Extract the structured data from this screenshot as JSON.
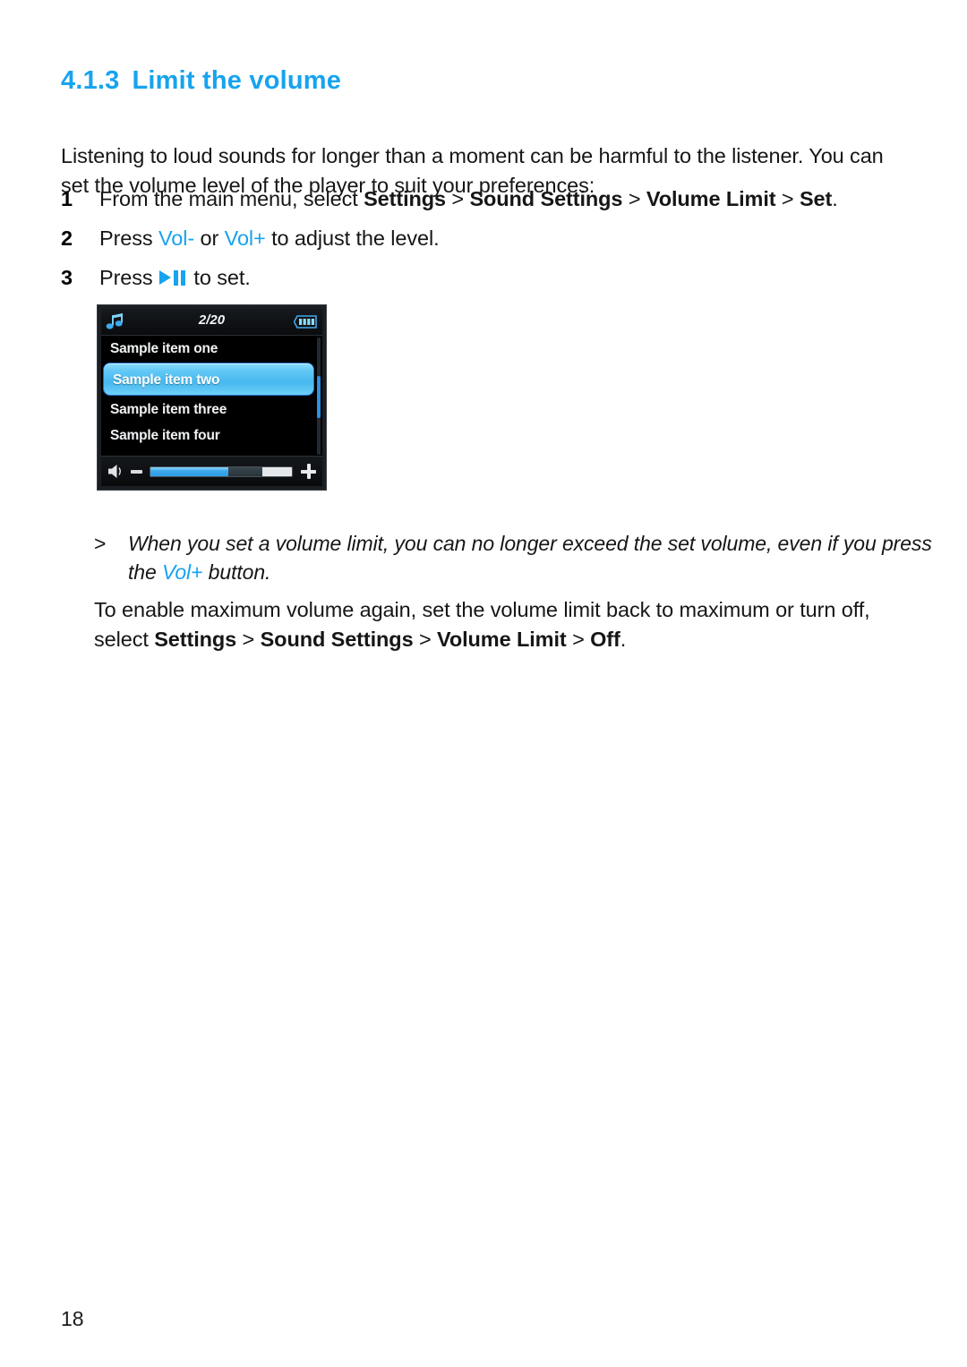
{
  "document": {
    "heading": {
      "number": "4.1.3",
      "title": "Limit the volume"
    },
    "intro": "Listening to loud sounds for longer than a moment can be harmful to the listener. You can set the volume level of the player to suit your preferences:",
    "steps": [
      {
        "index": "1",
        "prefix": "From the main menu, select ",
        "bold1": "Settings",
        "sep1": " > ",
        "bold2": "Sound Settings",
        "sep2": " > ",
        "bold3": "Volume Limit",
        "sep3": " > ",
        "bold4": "Set",
        "suffix": "."
      },
      {
        "index": "2",
        "prefix": "Press ",
        "key_minus": "Vol-",
        "middle": " or ",
        "key_plus": "Vol+",
        "suffix": " to adjust the level."
      },
      {
        "index": "3",
        "prefix": "Press ",
        "icon": "play-pause-icon",
        "suffix": " to set."
      }
    ],
    "note": {
      "marker": ">",
      "text_before": "When you set a volume limit, you can no longer exceed the set volume, even if you press the ",
      "key": "Vol+",
      "text_after": " button."
    },
    "closing": {
      "line1": "To enable maximum volume again, set the volume limit back to maximum or turn off, select ",
      "bold1": "Settings",
      "sep1": " > ",
      "bold2": "Sound Settings",
      "sep2": " > ",
      "bold3": "Volume Limit",
      "sep3": " > ",
      "bold4": "Off",
      "suffix": "."
    },
    "page_number": "18"
  },
  "device_screen": {
    "status_bar": {
      "mode_icon": "music-note-icon",
      "position": "2/20",
      "battery_icon": "battery-full-icon"
    },
    "list_items": [
      {
        "label": "Sample item one",
        "selected": false
      },
      {
        "label": "Sample item two",
        "selected": true
      },
      {
        "label": "Sample item three",
        "selected": false
      },
      {
        "label": "Sample item four",
        "selected": false
      }
    ],
    "volume_bar": {
      "speaker_icon": "speaker-icon",
      "decrease_icon": "minus-icon",
      "increase_icon": "plus-icon",
      "level_percent": 55,
      "limit_percent": 79
    }
  },
  "colors": {
    "accent_blue": "#17a3ef",
    "screen_background": "#000000",
    "highlight_blue": "#46b8ef",
    "text_black": "#161616"
  }
}
